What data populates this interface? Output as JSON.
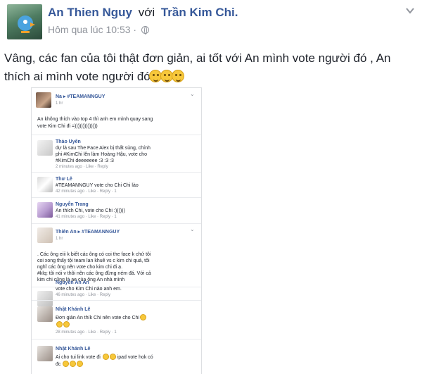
{
  "post": {
    "author": "An Thien Nguy",
    "with_word": "với",
    "tagged": "Trần Kim Chi.",
    "time": "Hôm qua lúc 10:53 ·",
    "text_line1": "Vâng, các fan của tôi thật đơn giản, ai tốt với An mình vote người đó , An",
    "text_line2": "thích ai mình vote người đó",
    "menu_icon": "chevron-down-icon"
  },
  "embed": {
    "op_author": "Na ▸ #TEAMANNGUY",
    "op_time": "1 hr",
    "op_text_1": "An không thích vào top 4 thì anh em mình quay sang",
    "op_text_2": "vote Kim Chi đi =))))))))))))))",
    "comments": [
      {
        "author": "Thảo Uyên",
        "l1": "dự là sau The Face Alex bị thất sủng, chính",
        "l2": "phi #KimChi lên làm Hoàng Hậu, vote cho",
        "l3": "#KimChi deeeeeee :3 :3 :3",
        "meta": "2 minutes ago · Like · Reply"
      },
      {
        "author": "Thư Lê",
        "l1": "#TEAMANNGUY vote cho Chi Chi lào",
        "meta": "42 minutes ago · Like · Reply · 1"
      },
      {
        "author": "Nguyễn Trang",
        "l1": "An thích Chi, vote cho Chi :))))))",
        "meta": "41 minutes ago · Like · Reply · 1"
      },
      {
        "author": "Thiên An ▸ #TEAMANNGUY",
        "l1": "1 hr"
      },
      {
        "l1": ". Các ông eiii k biết các ông có coi the face k chứ tôi",
        "l2": "coi xong thấy tội team lan khuê vs c kim chi quá, tôi",
        "l3": "nghĩ các ông nên vote cho kim chi đi ạ.",
        "l4": "#klq: tôi nói v thôi nên các ông đừng ném đá. Với cả",
        "l5": "kim chi cũng là ae của ông An nhà mình"
      },
      {
        "author": "Nguyễn An An",
        "l1": "vote cho Kim Chi nào anh em.",
        "meta": "46 minutes ago · Like · Reply"
      },
      {
        "author": "Nhật Khánh Lê",
        "l1": "Đơn giản An thík Chi nên vote cho Chi",
        "meta": "28 minutes ago · Like · Reply · 1"
      },
      {
        "author": "Nhật Khánh Lê",
        "l1": "Ai cho tui link vote đi",
        "l1b": "ipad vote hok có",
        "l2": "đc"
      }
    ]
  }
}
